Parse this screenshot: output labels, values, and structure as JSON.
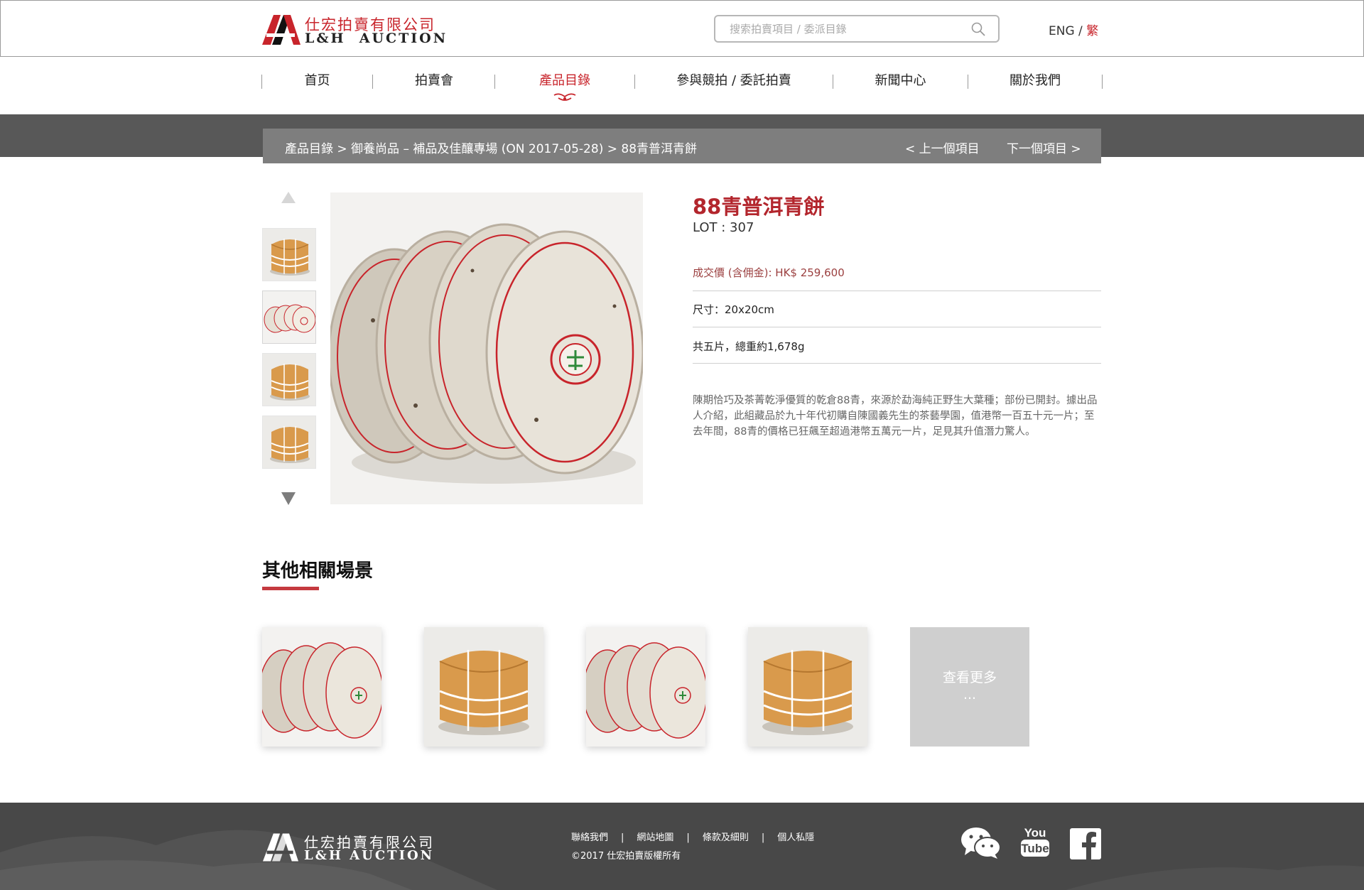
{
  "header": {
    "logo_cn": "仕宏拍賣有限公司",
    "logo_en_1": "L&H",
    "logo_en_2": "AUCTION",
    "search_placeholder": "搜索拍賣項目 / 委派目錄",
    "lang_en": "ENG",
    "lang_sep": "/",
    "lang_tc": "繁"
  },
  "nav": {
    "items": [
      "首页",
      "拍賣會",
      "產品目錄",
      "參與競拍 / 委託拍賣",
      "新聞中心",
      "關於我們"
    ],
    "active_index": 2
  },
  "breadcrumb": {
    "path": "產品目錄 > 御養尚品 – 補品及佳釀專場 (ON 2017-05-28) > 88青普洱青餅",
    "prev": "< 上一個項目",
    "next": "下一個項目 >"
  },
  "product": {
    "title": "88青普洱青餅",
    "lot": "LOT : 307",
    "price": "成交價 (含佣金): HK$ 259,600",
    "size": "尺寸：20x20cm",
    "weight": "共五片，總重約1,678g",
    "description": "陳期恰巧及茶菁乾淨優質的乾倉88青，來源於勐海純正野生大葉種；部份已開封。據出品人介紹，此組藏品於九十年代初購自陳國義先生的茶藝學園，值港幣一百五十元一片；至去年間，88青的價格已狂飆至超過港幣五萬元一片，足見其升值潛力驚人。"
  },
  "related": {
    "title": "其他相關場景",
    "more_label": "查看更多",
    "more_dots": "..."
  },
  "footer": {
    "logo_cn": "仕宏拍賣有限公司",
    "logo_en": "L&H  AUCTION",
    "links": [
      "聯絡我們",
      "網站地圖",
      "條款及細則",
      "個人私隱"
    ],
    "sep": "|",
    "copyright": "©2017 仕宏拍賣版權所有"
  },
  "colors": {
    "brand_red": "#c8242b",
    "band_dark": "#585858",
    "band_light": "#7e7e7e",
    "footer_bg": "#484848"
  },
  "icons": [
    "search-icon",
    "wechat-icon",
    "youtube-icon",
    "facebook-icon",
    "arrow-up-icon",
    "arrow-down-icon"
  ]
}
